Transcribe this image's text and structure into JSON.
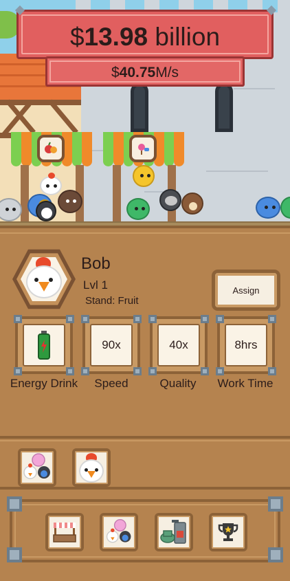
{
  "hud": {
    "total_prefix": "$",
    "total_value": "13.98",
    "total_unit": " billion",
    "rate_prefix": "$",
    "rate_value": "40.75",
    "rate_unit": "M/s"
  },
  "scene": {
    "stands": [
      {
        "name": "fruit-stand",
        "sign_icon": "fruit-icon",
        "awning_colors": [
          "#7ccf50",
          "#f08a2a"
        ]
      },
      {
        "name": "candy-stand",
        "sign_icon": "candy-icon",
        "awning_colors": [
          "#7ccf50",
          "#f08a2a"
        ]
      }
    ]
  },
  "worker": {
    "name": "Bob",
    "level": "Lvl 1",
    "stand": "Stand: Fruit",
    "avatar_icon": "chicken-icon",
    "assign_label": "Assign"
  },
  "stats": [
    {
      "name": "energy-drink",
      "value_icon": "energy-drink-icon",
      "label": "Energy Drink"
    },
    {
      "name": "speed",
      "value": "90x",
      "label": "Speed"
    },
    {
      "name": "quality",
      "value": "40x",
      "label": "Quality"
    },
    {
      "name": "work-time",
      "value": "8hrs",
      "label": "Work Time"
    }
  ],
  "roster": [
    {
      "name": "worker-group-slot",
      "icon": "animal-group-icon"
    },
    {
      "name": "worker-bob-slot",
      "icon": "chicken-icon"
    }
  ],
  "nav": [
    {
      "name": "nav-stands-button",
      "icon": "market-stand-icon"
    },
    {
      "name": "nav-workers-button",
      "icon": "animal-group-icon"
    },
    {
      "name": "nav-machines-button",
      "icon": "machine-icon"
    },
    {
      "name": "nav-achievements-button",
      "icon": "trophy-icon"
    }
  ],
  "colors": {
    "panel_bg": "#b5834f",
    "panel_border": "#8c6238",
    "banner_red": "#e15f5f",
    "card_face": "#faf3e6",
    "text": "#2b1c1a"
  }
}
